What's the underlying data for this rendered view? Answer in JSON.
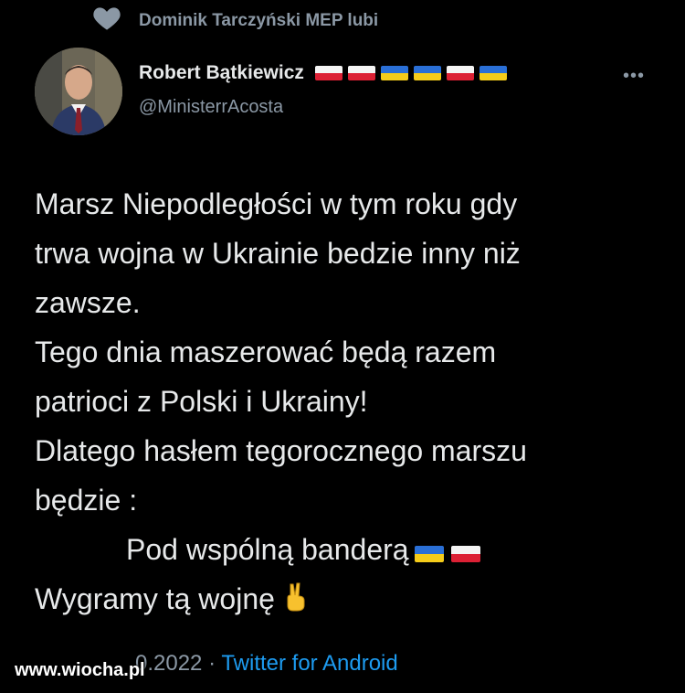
{
  "social_context": {
    "icon": "heart-icon",
    "text": "Dominik Tarczyński MEP lubi"
  },
  "author": {
    "name": "Robert Bątkiewicz",
    "handle": "@MinisterrAcosta",
    "name_flags": [
      "pl",
      "pl",
      "ua",
      "ua",
      "pl",
      "ua"
    ]
  },
  "tweet": {
    "lines": [
      "Marsz Niepodległości w tym roku gdy",
      "trwa wojna w Ukrainie bedzie inny niż",
      "zawsze.",
      "Tego dnia maszerować będą razem",
      "patrioci z Polski i Ukrainy!",
      "Dlatego hasłem tegorocznego marszu",
      "będzie :",
      "Pod wspólną banderą",
      "Wygramy tą wojnę"
    ],
    "slogan_flags": [
      "ua",
      "pl"
    ],
    "end_emoji": "victory-hand-icon"
  },
  "meta": {
    "date": "0.2022",
    "separator": "·",
    "source": "Twitter for Android"
  },
  "watermark": "www.wiocha.pl",
  "colors": {
    "background": "#000000",
    "text": "#e7e9ea",
    "muted": "#8b98a5",
    "link": "#1d9bf0",
    "pl_white": "#f4f4f4",
    "pl_red": "#dc2034",
    "ua_blue": "#2a6fd6",
    "ua_yellow": "#f5cc1a"
  }
}
